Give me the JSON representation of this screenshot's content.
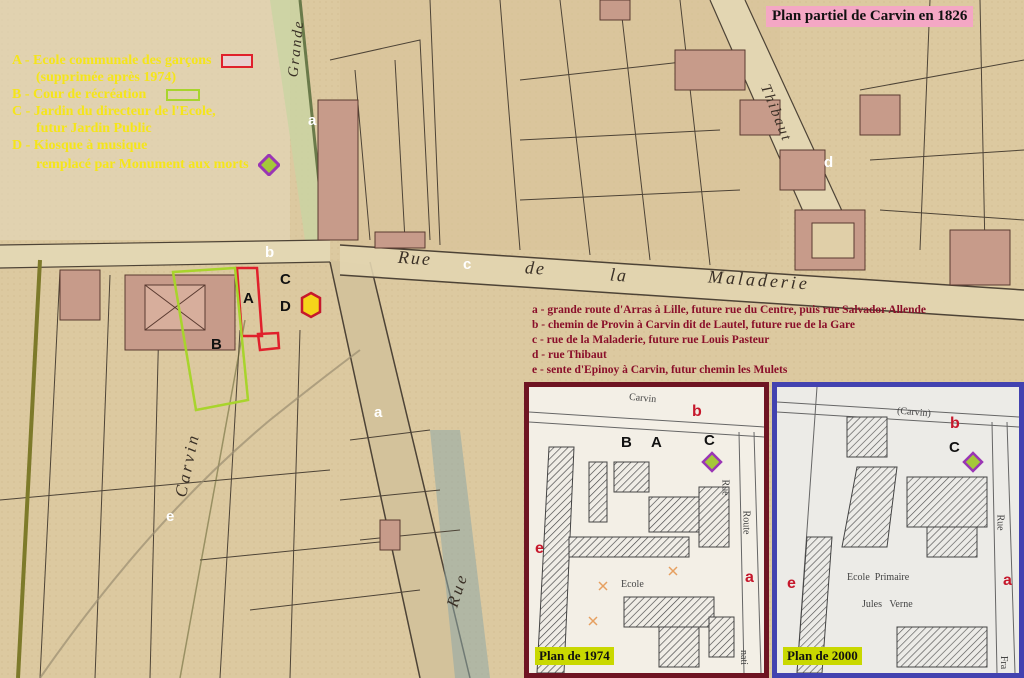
{
  "title": "Plan partiel de Carvin en 1826",
  "legend": {
    "items": [
      {
        "line1": "A - Ecole communale des garçons",
        "line2": "(supprimée après 1974)",
        "swatch": "red-rect"
      },
      {
        "line1": "B - Cour de récréation",
        "swatch": "green-rect"
      },
      {
        "line1": "C - Jardin du directeur de l'Ecole,",
        "line2": "futur Jardin Public"
      },
      {
        "line1": "D - Kiosque à musique",
        "line2": "remplacé par Monument aux morts",
        "swatch": "diamond"
      }
    ]
  },
  "streets_legend": [
    "a - grande route d'Arras à Lille, future rue du Centre, puis rue Salvador Allende",
    "b - chemin de Provin à Carvin dit de Lautel, future rue de la Gare",
    "c - rue de la Maladerie, future rue Louis Pasteur",
    "d - rue Thibaut",
    "e - sente d'Epinoy à Carvin, futur chemin les Mulets"
  ],
  "map_labels": {
    "a": "a",
    "b": "b",
    "c": "c",
    "d": "d",
    "e": "e",
    "A": "A",
    "B": "B",
    "C": "C",
    "D": "D"
  },
  "street_names": {
    "grande": "Grande",
    "thibaut": "Thibaut",
    "maladerie_rue": "Rue",
    "maladerie_c": "c",
    "maladerie_de": "de",
    "maladerie_la": "la",
    "maladerie_name": "Maladerie",
    "carvin": "Carvin",
    "rue_bottom": "Rue"
  },
  "inset_1974": {
    "caption": "Plan de 1974",
    "labels": {
      "B": "B",
      "A": "A",
      "C": "C",
      "b": "b",
      "a": "a",
      "e": "e"
    },
    "text": {
      "carvin": "Carvin",
      "rue": "Rue",
      "route": "Route",
      "ecole": "Ecole",
      "nat": "nati"
    }
  },
  "inset_2000": {
    "caption": "Plan de 2000",
    "labels": {
      "C": "C",
      "b": "b",
      "a": "a",
      "e": "e"
    },
    "text": {
      "carvin": "(Carvin)",
      "rue": "Rue",
      "fra": "Fra",
      "ecole": "Ecole  Primaire",
      "jules": "Jules   Verne"
    }
  },
  "colors": {
    "red": "#e0202c",
    "green": "#a8d42c",
    "yellow_legend": "#f5e51a",
    "diamond_fill": "#a4c83a",
    "diamond_border": "#9a35b5",
    "hexagon_fill": "#f5d41a",
    "title_bg": "#f4a7c4"
  }
}
